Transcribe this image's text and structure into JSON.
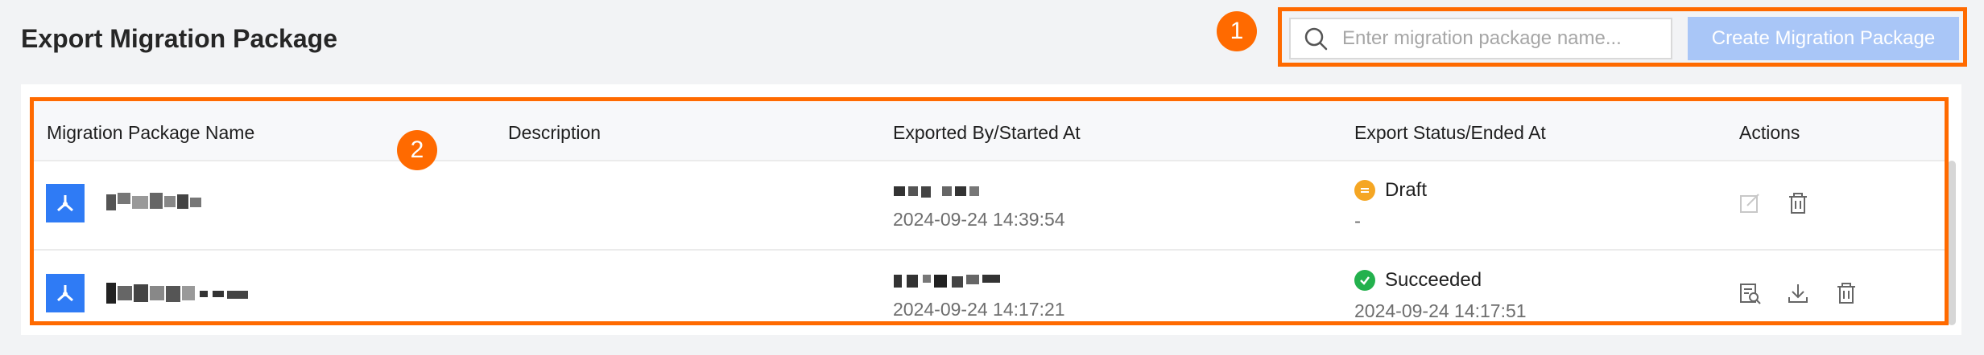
{
  "page": {
    "title": "Export Migration Package"
  },
  "annotations": {
    "badge1": "1",
    "badge2": "2"
  },
  "toolbar": {
    "search_placeholder": "Enter migration package name...",
    "create_label": "Create Migration Package"
  },
  "table": {
    "columns": [
      "Migration Package Name",
      "Description",
      "Exported By/Started At",
      "Export Status/Ended At",
      "Actions"
    ],
    "rows": [
      {
        "name": "",
        "description": "",
        "started_at": "2024-09-24 14:39:54",
        "status": "Draft",
        "status_color": "#f5a623",
        "ended_at": "-",
        "actions": [
          "edit-icon",
          "delete-icon"
        ]
      },
      {
        "name": "",
        "description": "",
        "started_at": "2024-09-24 14:17:21",
        "status": "Succeeded",
        "status_color": "#23b14d",
        "ended_at": "2024-09-24 14:17:51",
        "actions": [
          "view-details-icon",
          "download-icon",
          "delete-icon"
        ]
      }
    ]
  },
  "colors": {
    "accent": "#ff6a00",
    "primary_disabled": "#a9c6f7",
    "package_icon": "#2f7bf5"
  }
}
